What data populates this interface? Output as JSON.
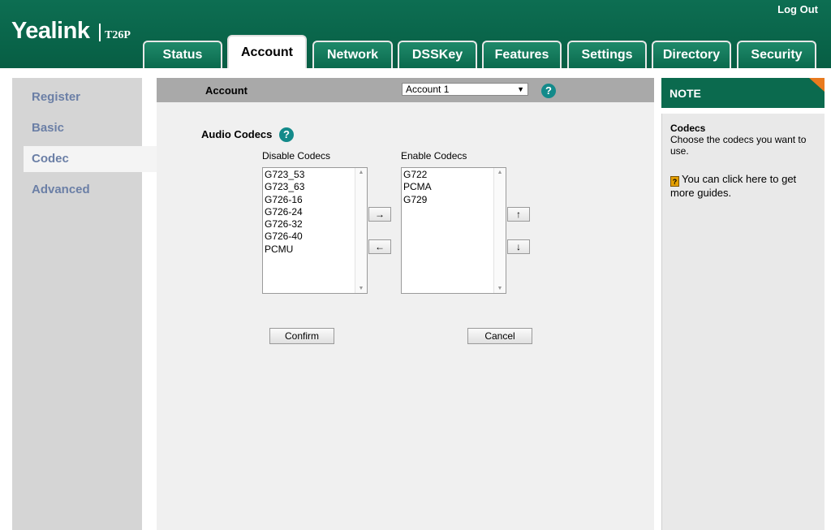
{
  "header": {
    "brand": "Yealink",
    "model": "T26P",
    "logout": "Log Out",
    "tabs": [
      "Status",
      "Account",
      "Network",
      "DSSKey",
      "Features",
      "Settings",
      "Directory",
      "Security"
    ],
    "active_tab": "Account"
  },
  "sidebar": {
    "items": [
      "Register",
      "Basic",
      "Codec",
      "Advanced"
    ],
    "active": "Codec"
  },
  "account_bar": {
    "label": "Account",
    "selected": "Account 1",
    "help": "?"
  },
  "codecs": {
    "title": "Audio Codecs",
    "help": "?",
    "disable_label": "Disable Codecs",
    "enable_label": "Enable Codecs",
    "disabled": [
      "G723_53",
      "G723_63",
      "G726-16",
      "G726-24",
      "G726-32",
      "G726-40",
      "PCMU"
    ],
    "enabled": [
      "G722",
      "PCMA",
      "G729"
    ],
    "move_right": "→",
    "move_left": "←",
    "move_up": "↑",
    "move_down": "↓"
  },
  "actions": {
    "confirm": "Confirm",
    "cancel": "Cancel"
  },
  "note": {
    "title": "NOTE",
    "heading": "Codecs",
    "desc": "Choose the codecs you want to use.",
    "guide": "You can click here to get more guides.",
    "guide_icon": "?"
  },
  "colors": {
    "header_green": "#0b6a4e",
    "sidebar_link": "#6b7fa6",
    "help_teal": "#138a8a",
    "note_corner": "#e87a1e"
  }
}
